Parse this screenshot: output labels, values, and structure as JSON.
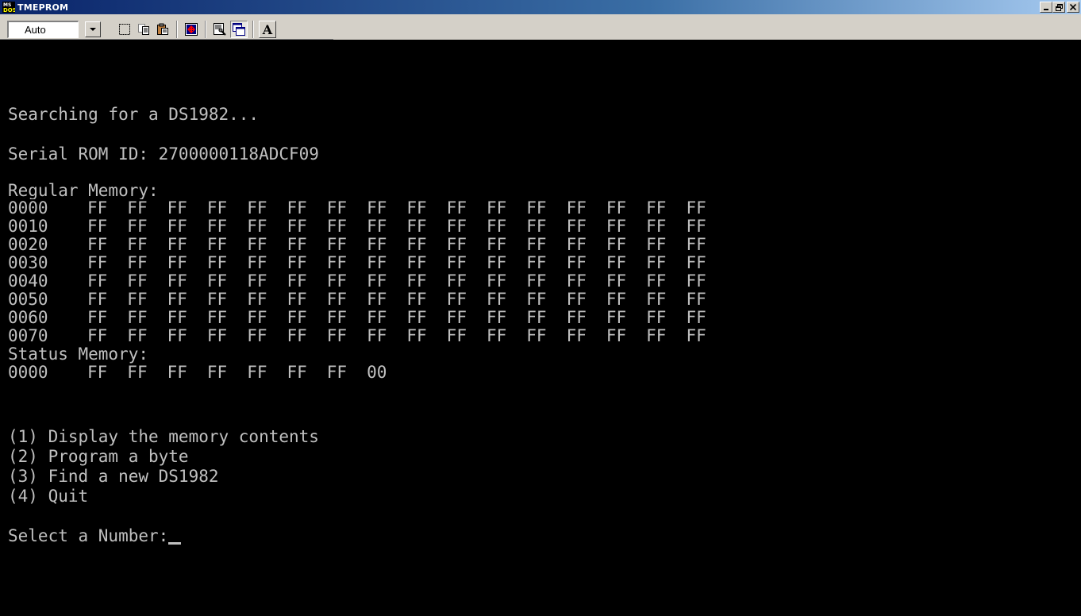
{
  "window": {
    "title": "TMEPROM",
    "icon": "ms-dos-icon",
    "controls": [
      "_",
      "8",
      "x"
    ]
  },
  "toolbar": {
    "font_size_value": "Auto",
    "buttons": [
      {
        "name": "mark-icon"
      },
      {
        "name": "copy-icon"
      },
      {
        "name": "paste-icon"
      },
      {
        "name": "fullscreen-icon"
      },
      {
        "name": "properties-icon"
      },
      {
        "name": "background-icon",
        "pressed": true
      },
      {
        "name": "font-icon",
        "glyph": "A"
      }
    ]
  },
  "console": {
    "searching": "Searching for a DS1982...",
    "serial_label": "Serial ROM ID: 2700000118ADCF09",
    "regular_memory_label": "Regular Memory:",
    "regular_memory": [
      {
        "addr": "0000",
        "bytes": [
          "FF",
          "FF",
          "FF",
          "FF",
          "FF",
          "FF",
          "FF",
          "FF",
          "FF",
          "FF",
          "FF",
          "FF",
          "FF",
          "FF",
          "FF",
          "FF"
        ]
      },
      {
        "addr": "0010",
        "bytes": [
          "FF",
          "FF",
          "FF",
          "FF",
          "FF",
          "FF",
          "FF",
          "FF",
          "FF",
          "FF",
          "FF",
          "FF",
          "FF",
          "FF",
          "FF",
          "FF"
        ]
      },
      {
        "addr": "0020",
        "bytes": [
          "FF",
          "FF",
          "FF",
          "FF",
          "FF",
          "FF",
          "FF",
          "FF",
          "FF",
          "FF",
          "FF",
          "FF",
          "FF",
          "FF",
          "FF",
          "FF"
        ]
      },
      {
        "addr": "0030",
        "bytes": [
          "FF",
          "FF",
          "FF",
          "FF",
          "FF",
          "FF",
          "FF",
          "FF",
          "FF",
          "FF",
          "FF",
          "FF",
          "FF",
          "FF",
          "FF",
          "FF"
        ]
      },
      {
        "addr": "0040",
        "bytes": [
          "FF",
          "FF",
          "FF",
          "FF",
          "FF",
          "FF",
          "FF",
          "FF",
          "FF",
          "FF",
          "FF",
          "FF",
          "FF",
          "FF",
          "FF",
          "FF"
        ]
      },
      {
        "addr": "0050",
        "bytes": [
          "FF",
          "FF",
          "FF",
          "FF",
          "FF",
          "FF",
          "FF",
          "FF",
          "FF",
          "FF",
          "FF",
          "FF",
          "FF",
          "FF",
          "FF",
          "FF"
        ]
      },
      {
        "addr": "0060",
        "bytes": [
          "FF",
          "FF",
          "FF",
          "FF",
          "FF",
          "FF",
          "FF",
          "FF",
          "FF",
          "FF",
          "FF",
          "FF",
          "FF",
          "FF",
          "FF",
          "FF"
        ]
      },
      {
        "addr": "0070",
        "bytes": [
          "FF",
          "FF",
          "FF",
          "FF",
          "FF",
          "FF",
          "FF",
          "FF",
          "FF",
          "FF",
          "FF",
          "FF",
          "FF",
          "FF",
          "FF",
          "FF"
        ]
      }
    ],
    "status_memory_label": "Status Memory:",
    "status_memory": [
      {
        "addr": "0000",
        "bytes": [
          "FF",
          "FF",
          "FF",
          "FF",
          "FF",
          "FF",
          "FF",
          "00"
        ]
      }
    ],
    "menu": [
      "(1) Display the memory contents",
      "(2) Program a byte",
      "(3) Find a new DS1982",
      "(4) Quit"
    ],
    "prompt": "Select a Number:"
  }
}
